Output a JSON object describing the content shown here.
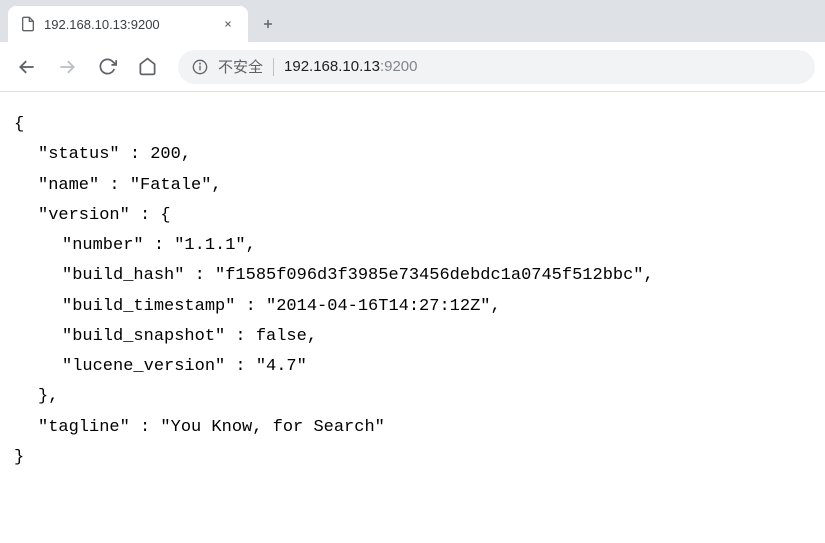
{
  "tab": {
    "title": "192.168.10.13:9200"
  },
  "addressBar": {
    "securityLabel": "不安全",
    "host": "192.168.10.13",
    "port": ":9200"
  },
  "json": {
    "open": "{",
    "status_line": "\"status\" : 200,",
    "name_line": "\"name\" : \"Fatale\",",
    "version_open": "\"version\" : {",
    "number_line": "\"number\" : \"1.1.1\",",
    "build_hash_line": "\"build_hash\" : \"f1585f096d3f3985e73456debdc1a0745f512bbc\",",
    "build_timestamp_line": "\"build_timestamp\" : \"2014-04-16T14:27:12Z\",",
    "build_snapshot_line": "\"build_snapshot\" : false,",
    "lucene_version_line": "\"lucene_version\" : \"4.7\"",
    "version_close": "},",
    "tagline_line": "\"tagline\" : \"You Know, for Search\"",
    "close": "}"
  }
}
